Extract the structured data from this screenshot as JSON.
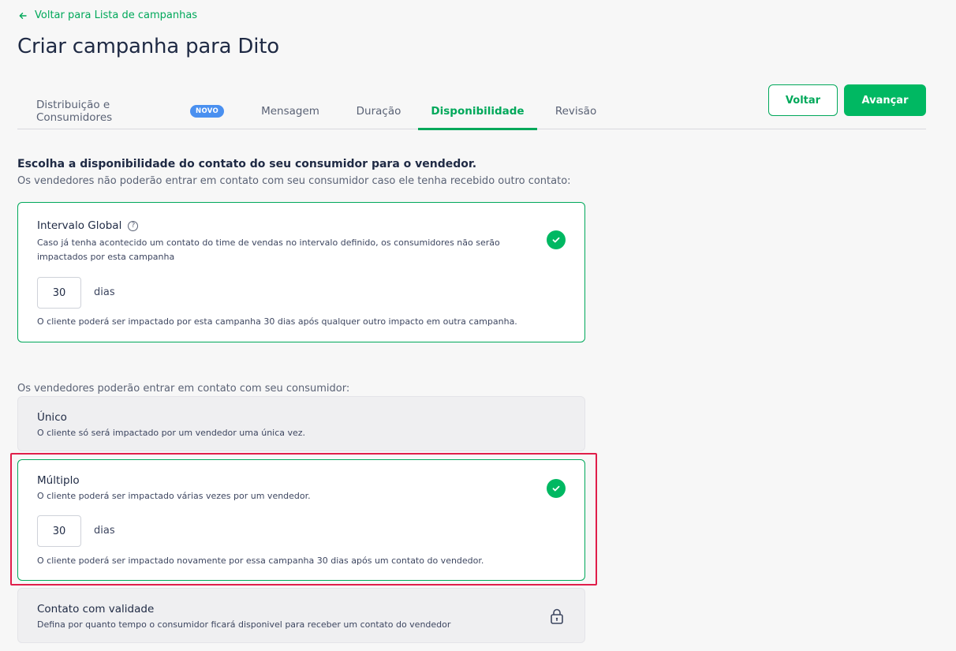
{
  "back_link": {
    "label": "Voltar para Lista de campanhas"
  },
  "page": {
    "title": "Criar campanha para Dito"
  },
  "tabs": [
    {
      "label": "Distribuição e Consumidores",
      "badge": "NOVO"
    },
    {
      "label": "Mensagem"
    },
    {
      "label": "Duração"
    },
    {
      "label": "Disponibilidade",
      "active": true
    },
    {
      "label": "Revisão"
    }
  ],
  "actions": {
    "back_label": "Voltar",
    "next_label": "Avançar"
  },
  "section": {
    "title": "Escolha a disponibilidade do contato do seu consumidor para o vendedor.",
    "subtitle": "Os vendedores não poderão entrar em contato com seu consumidor caso ele tenha recebido outro contato:"
  },
  "global_interval": {
    "title": "Intervalo Global",
    "description": "Caso já tenha acontecido um contato do time de vendas no intervalo definido, os consumidores não serão impactados por esta campanha",
    "days_value": "30",
    "days_unit": "dias",
    "note": "O cliente poderá ser impactado por esta campanha 30 dias após qualquer outro impacto em outra campanha.",
    "selected": true
  },
  "contact_options_label": "Os vendedores poderão entrar em contato com seu consumidor:",
  "options": {
    "unico": {
      "title": "Único",
      "description": "O cliente só será impactado por um vendedor uma única vez."
    },
    "multiplo": {
      "title": "Múltiplo",
      "description": "O cliente poderá ser impactado várias vezes por um vendedor.",
      "days_value": "30",
      "days_unit": "dias",
      "note": "O cliente poderá ser impactado novamente por essa campanha 30 dias após um contato do vendedor.",
      "selected": true
    },
    "validade": {
      "title": "Contato com validade",
      "description": "Defina por quanto tempo o consumidor ficará disponivel para receber um contato do vendedor",
      "locked": true
    }
  },
  "colors": {
    "accent": "#00a85a",
    "primary_button": "#00b862",
    "badge": "#4a90f0",
    "highlight": "#e01e4a"
  }
}
